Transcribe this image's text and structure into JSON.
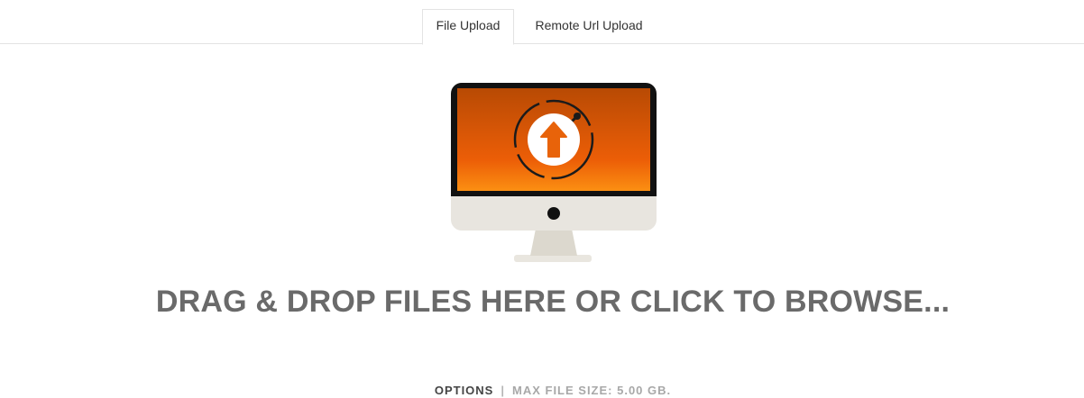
{
  "tabs": [
    {
      "label": "File Upload",
      "active": true
    },
    {
      "label": "Remote Url Upload",
      "active": false
    }
  ],
  "dropzone": {
    "text": "DRAG & DROP FILES HERE OR CLICK TO BROWSE...",
    "illustration": "monitor-upload-icon",
    "accent_color": "#e8630a"
  },
  "footer": {
    "options_label": "OPTIONS",
    "separator": "|",
    "max_file_size": "MAX FILE SIZE: 5.00 GB."
  }
}
